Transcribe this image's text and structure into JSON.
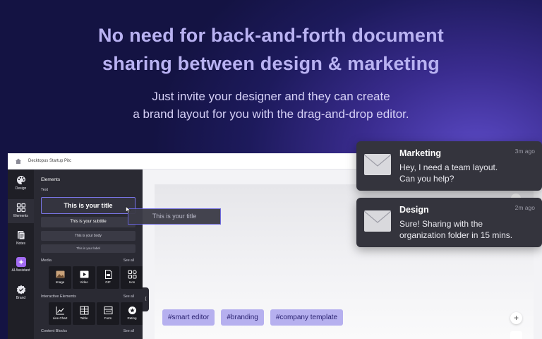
{
  "hero": {
    "title_line1": "No need for back-and-forth document",
    "title_line2": "sharing between design & marketing",
    "sub_line1": "Just invite your designer and they can create",
    "sub_line2": "a brand layout for you with the drag-and-drop editor."
  },
  "app": {
    "breadcrumb": "Decktopus Startup Pitc",
    "rail": [
      {
        "label": "Design",
        "icon": "palette-icon"
      },
      {
        "label": "Elements",
        "icon": "grid-icon"
      },
      {
        "label": "Notes",
        "icon": "notes-icon"
      },
      {
        "label": "AI Assistant",
        "icon": "sparkle-icon"
      },
      {
        "label": "Brand",
        "icon": "badge-check-icon"
      }
    ],
    "panel": {
      "title": "Elements",
      "text_section": "Text",
      "text_items": {
        "title": "This is your title",
        "subtitle": "This is your subtitle",
        "body": "This is your body",
        "label": "This is your label"
      },
      "media_section": "Media",
      "media_see_all": "See all",
      "media_items": [
        "Image",
        "Video",
        "GIF",
        "Icon"
      ],
      "interactive_section": "Interactive Elements",
      "interactive_see_all": "See all",
      "interactive_items": [
        "Line Chart",
        "Table",
        "Form",
        "Rating"
      ],
      "content_section": "Content Blocks",
      "content_see_all": "See all"
    },
    "drag_ghost": "This is your title",
    "tags": [
      "#smart editor",
      "#branding",
      "#company  template"
    ]
  },
  "notifications": [
    {
      "name": "Marketing",
      "time": "3m ago",
      "line1": "Hey, I need a team layout.",
      "line2": "Can you help?"
    },
    {
      "name": "Design",
      "time": "2m ago",
      "line1": "Sure! Sharing with the",
      "line2": "organization folder in 15 mins."
    }
  ],
  "colors": {
    "accent": "#7a76e8",
    "tag_bg": "#b6b0ef",
    "hero_title": "#b9b2f2"
  }
}
